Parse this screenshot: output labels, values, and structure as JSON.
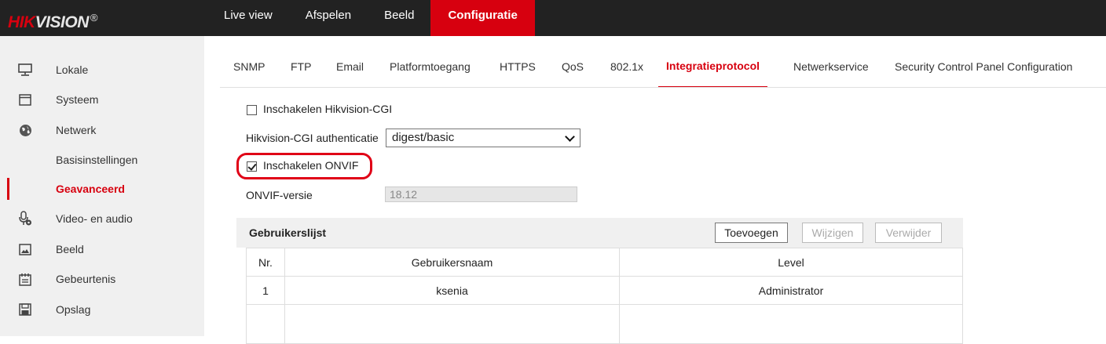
{
  "brand": {
    "logo_part1": "HIK",
    "logo_part2": "VISION",
    "logo_reg": "®"
  },
  "topnav": [
    {
      "label": "Live view"
    },
    {
      "label": "Afspelen"
    },
    {
      "label": "Beeld"
    },
    {
      "label": "Configuratie",
      "active": true
    }
  ],
  "sidebar": {
    "items": [
      {
        "label": "Lokale",
        "icon": "monitor-icon"
      },
      {
        "label": "Systeem",
        "icon": "window-icon"
      },
      {
        "label": "Netwerk",
        "icon": "globe-icon"
      },
      {
        "label": "Basisinstellingen",
        "sub": true
      },
      {
        "label": "Geavanceerd",
        "sub": true,
        "active": true
      },
      {
        "label": "Video- en audio",
        "icon": "microphone-icon"
      },
      {
        "label": "Beeld",
        "icon": "image-icon"
      },
      {
        "label": "Gebeurtenis",
        "icon": "calendar-icon"
      },
      {
        "label": "Opslag",
        "icon": "floppy-icon"
      }
    ]
  },
  "tabs": [
    {
      "label": "SNMP"
    },
    {
      "label": "FTP"
    },
    {
      "label": "Email"
    },
    {
      "label": "Platformtoegang"
    },
    {
      "label": "HTTPS"
    },
    {
      "label": "QoS"
    },
    {
      "label": "802.1x"
    },
    {
      "label": "Integratieprotocol",
      "active": true
    },
    {
      "label": "Netwerkservice"
    },
    {
      "label": "Security Control Panel Configuration"
    }
  ],
  "form": {
    "enable_cgi_label": "Inschakelen Hikvision-CGI",
    "enable_cgi_checked": false,
    "cgi_auth_label": "Hikvision-CGI authenticatie",
    "cgi_auth_value": "digest/basic",
    "enable_onvif_label": "Inschakelen ONVIF",
    "enable_onvif_checked": true,
    "onvif_version_label": "ONVIF-versie",
    "onvif_version_value": "18.12"
  },
  "user_list": {
    "title": "Gebruikerslijst",
    "buttons": {
      "add": "Toevoegen",
      "edit": "Wijzigen",
      "delete": "Verwijder"
    },
    "columns": [
      "Nr.",
      "Gebruikersnaam",
      "Level"
    ],
    "rows": [
      {
        "nr": "1",
        "username": "ksenia",
        "level": "Administrator"
      }
    ]
  },
  "colors": {
    "accent": "#d7000f",
    "topbar": "#222222",
    "sidebar": "#f0f0f0"
  }
}
